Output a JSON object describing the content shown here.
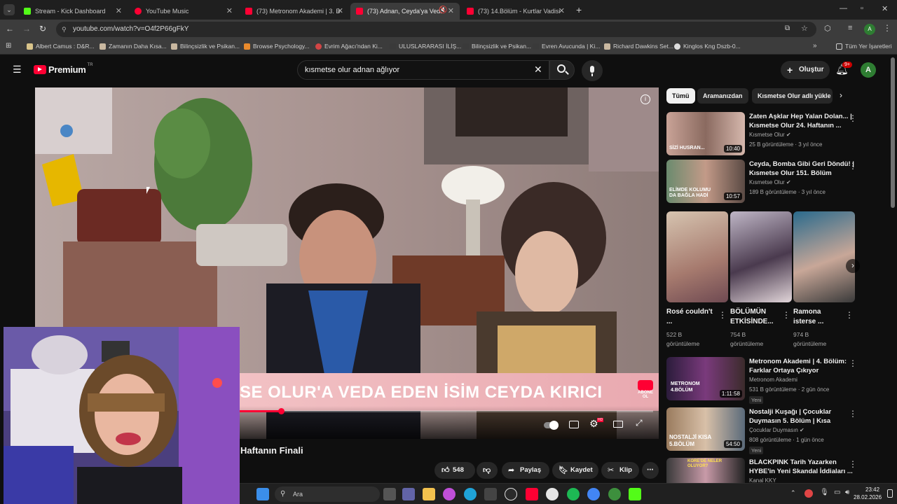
{
  "browser": {
    "tabs": [
      {
        "title": "Stream - Kick Dashboard",
        "color": "#53fc18"
      },
      {
        "title": "YouTube Music",
        "color": "#ff0033"
      },
      {
        "title": "(73) Metronom Akademi | 3. Bö",
        "color": "#ff0033"
      },
      {
        "title": "(73) Adnan, Ceyda'ya Veda",
        "color": "#ff0033"
      },
      {
        "title": "(73) 14.Bölüm - Kurtlar Vadisi |",
        "color": "#ff0033"
      }
    ],
    "url": "youtube.com/watch?v=O4f2P66gFkY",
    "bookmarks": [
      "Albert Camus : D&R...",
      "Zamanın Daha Kısa...",
      "Bilinçsizlik ve Psikan...",
      "Browse Psychology...",
      "Evrim Ağacı'ndan Ki...",
      "ULUSLARARASI İLİŞ...",
      "Bilinçsizlik ve Psikan...",
      "Evren Avucunda | Ki...",
      "Richard Dawkins Set...",
      "Kinglos Kng Dszb-0..."
    ],
    "all_bookmarks": "Tüm Yer İşaretleri"
  },
  "youtube": {
    "logo": "Premium",
    "logo_sup": "TR",
    "search_value": "kısmetse olur adnan ağlıyor",
    "create_label": "Oluştur",
    "notif_count": "9+",
    "avatar_letter": "A"
  },
  "video": {
    "overlay_text": "SE OLUR'A VEDA EDEN İSİM CEYDA KIRICI",
    "abone_label": "ABONE OL",
    "title_partial": "Haftanın Finali",
    "progress": 0.1
  },
  "actions": {
    "likes": "548",
    "share": "Paylaş",
    "save": "Kaydet",
    "clip": "Klip"
  },
  "chips": [
    "Tümü",
    "Aramanızdan",
    "Kısmetse Olur adlı yükle"
  ],
  "recommendations": [
    {
      "title": "Zaten Aşklar Hep Yalan Dolan... | Kısmetse Olur 24. Haftanın ...",
      "channel": "Kısmetse Olur",
      "meta": "25 B görüntüleme · 3 yıl önce",
      "duration": "10:40",
      "badge": "",
      "thumb_text": "SİZİ HUSRAN..."
    },
    {
      "title": "Ceyda, Bomba Gibi Geri Döndü! | Kısmetse Olur 151. Bölüm",
      "channel": "Kısmetse Olur",
      "meta": "189 B görüntüleme · 3 yıl önce",
      "duration": "10:57",
      "badge": "",
      "thumb_text": "ELİMDE KOLUMU DA BAĞLA HADİ"
    },
    {
      "title": "Metronom Akademi | 4. Bölüm: Farklar Ortaya Çıkıyor",
      "channel": "Metronom Akademi",
      "meta": "531 B görüntüleme · 2 gün önce",
      "duration": "1:11:58",
      "badge": "Yeni",
      "thumb_text": "METRONOM 4.BÖLÜM"
    },
    {
      "title": "Nostalji Kuşağı | Çocuklar Duymasın 5. Bölüm | Kısa",
      "channel": "Çocuklar Duymasın",
      "meta": "808 görüntüleme · 1 gün önce",
      "duration": "54:50",
      "badge": "Yeni",
      "thumb_text": "NOSTALJİ KISA 5.BÖLÜM"
    },
    {
      "title": "BLACKPINK Tarih Yazarken HYBE'in Yeni Skandal İddiaları ...",
      "channel": "Kanal KKY",
      "meta": "",
      "duration": "",
      "badge": "",
      "thumb_text": "KORE'DE NELER OLUYOR?"
    }
  ],
  "shorts": [
    {
      "title": "Rosé couldn't ...",
      "views": "522 B görüntüleme"
    },
    {
      "title": "BÖLÜMÜN ETKİSİNDE...",
      "views": "754 B görüntüleme"
    },
    {
      "title": "Ramona isterse ...",
      "views": "974 B görüntüleme"
    }
  ],
  "taskbar": {
    "search": "Ara",
    "time": "23:42",
    "date": "28.02.2026"
  },
  "colors": {
    "yt_red": "#ff0033",
    "kick_green": "#53fc18",
    "bg": "#0f0f0f"
  }
}
